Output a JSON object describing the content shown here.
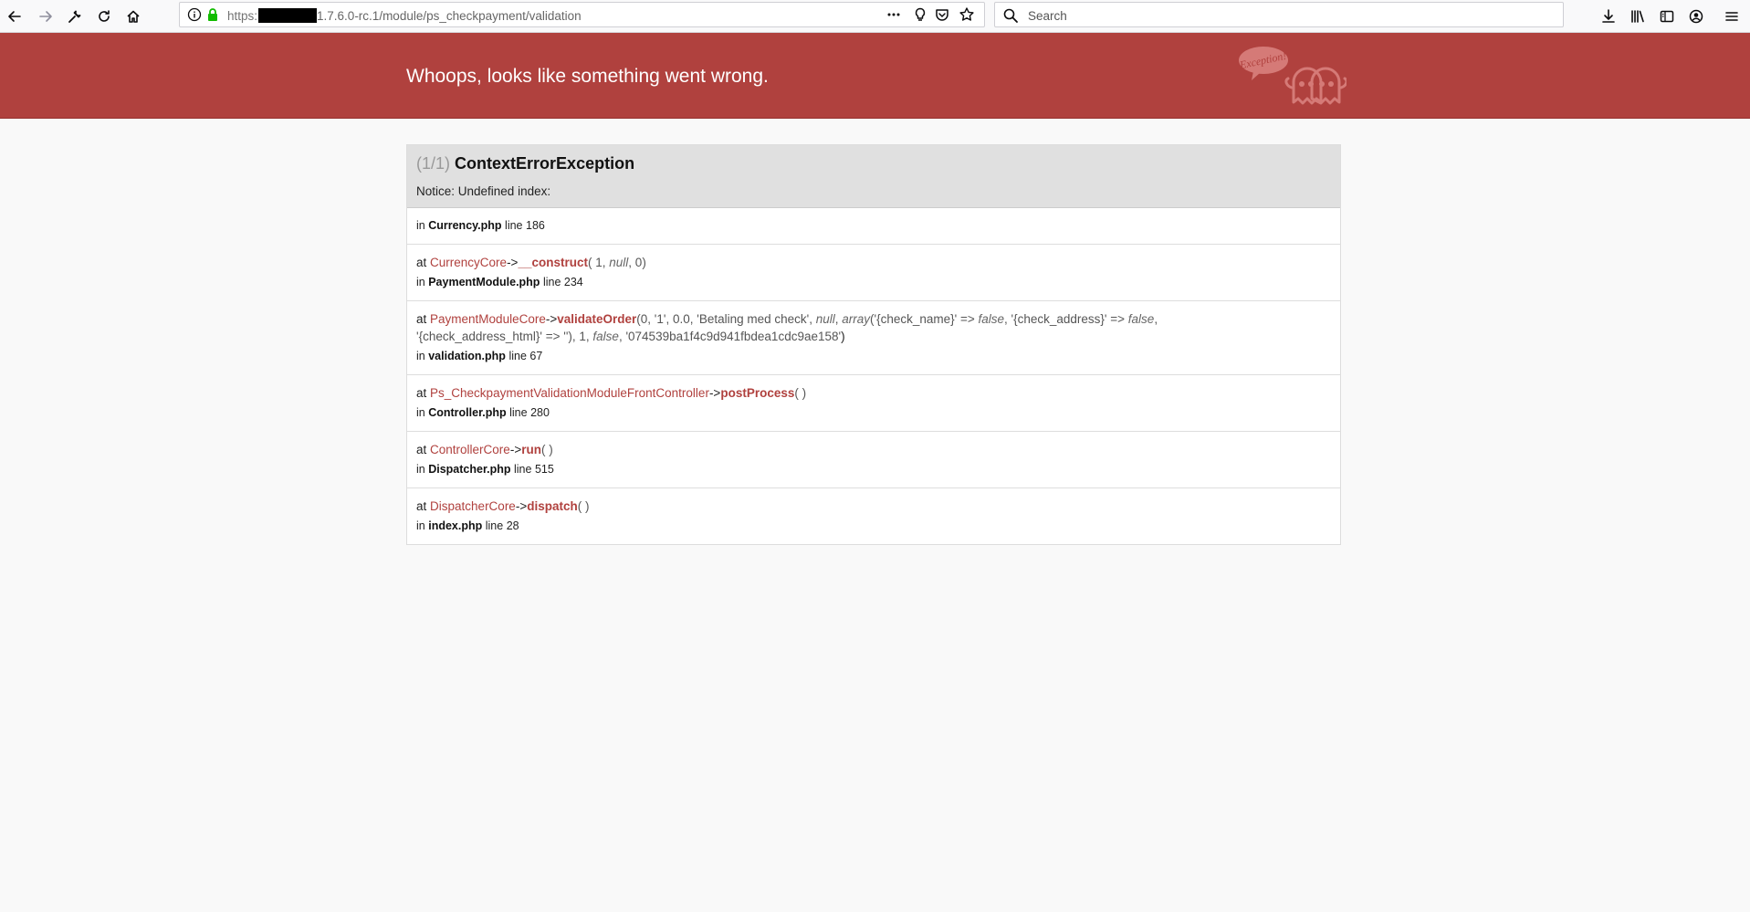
{
  "browser": {
    "url_scheme": "https:",
    "url_rest": "1.7.6.0-rc.1/module/ps_checkpayment/validation",
    "search_placeholder": "Search"
  },
  "page": {
    "header_title": "Whoops, looks like something went wrong.",
    "logo_text": "Exception!"
  },
  "exception": {
    "count": "(1/1)",
    "name": "ContextErrorException",
    "message": "Notice: Undefined index:"
  },
  "trace": {
    "first": {
      "file": "Currency.php",
      "line": "186"
    },
    "frames": [
      {
        "class": "CurrencyCore",
        "method": "__construct",
        "args": [
          "1",
          "null",
          "0"
        ],
        "file": "PaymentModule.php",
        "line": "234"
      },
      {
        "class": "PaymentModuleCore",
        "method": "validateOrder",
        "args_line1": "0, '1', 0.0, 'Betaling med check', ",
        "args_null": "null",
        "args_array": "array",
        "args_cont1": "('{check_name}' => ",
        "args_false1": "false",
        "args_cont2": ", '{check_address}' => ",
        "args_false2": "false",
        "args_cont3": ",",
        "args_line2a": "'{check_address_html}' => ''), 1, ",
        "args_false3": "false",
        "args_line2b": ", '074539ba1f4c9d941fbdea1cdc9ae158'",
        "file": "validation.php",
        "line": "67"
      },
      {
        "class": "Ps_CheckpaymentValidationModuleFrontController",
        "method": "postProcess",
        "file": "Controller.php",
        "line": "280"
      },
      {
        "class": "ControllerCore",
        "method": "run",
        "file": "Dispatcher.php",
        "line": "515"
      },
      {
        "class": "DispatcherCore",
        "method": "dispatch",
        "file": "index.php",
        "line": "28"
      }
    ],
    "labels": {
      "in": "in",
      "at": "at",
      "line": "line",
      "arrow": "->"
    }
  },
  "colors": {
    "header_bg": "#b0413e",
    "accent": "#b0413e"
  }
}
